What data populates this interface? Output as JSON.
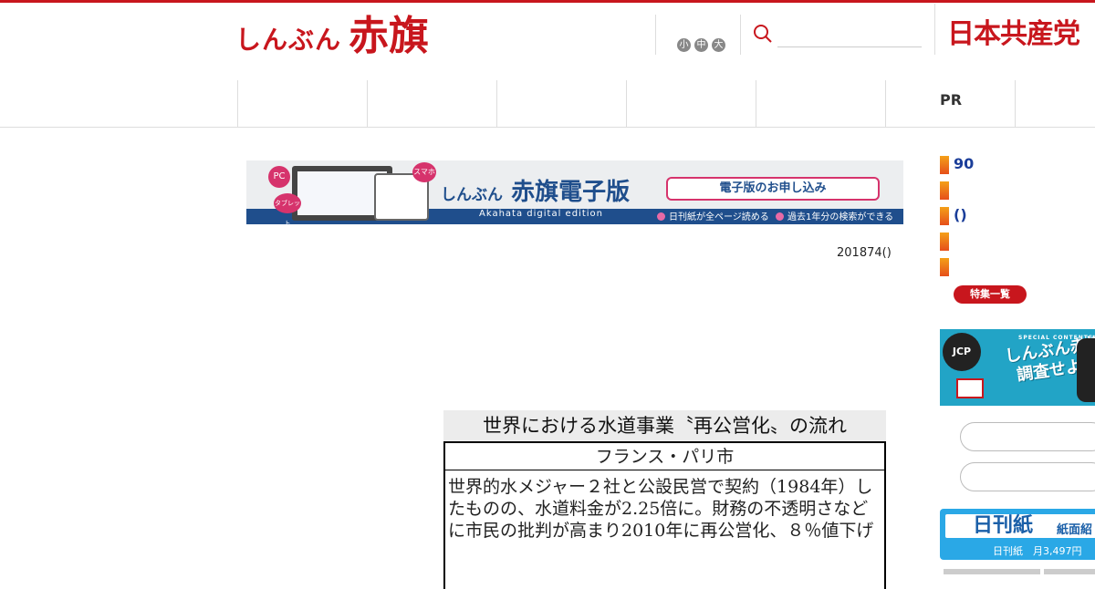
{
  "header": {
    "logo_small": "しんぶん",
    "logo_big": "赤旗",
    "font_sizes": [
      "小",
      "中",
      "大"
    ],
    "search_placeholder": "",
    "party_logo": "日本共産党"
  },
  "nav": {
    "pr_label": "PR"
  },
  "banner": {
    "title_small": "しんぶん",
    "title_big": "赤旗電子版",
    "cta": "電子版のお申し込み",
    "english": "Akahata digital edition",
    "feature1": "日刊紙が全ページ読める",
    "feature2": "過去1年分の検索ができる",
    "bubble_pc": "PC",
    "bubble_tablet": "タブレット",
    "bubble_phone": "スマホ"
  },
  "article": {
    "date": "201874()"
  },
  "table": {
    "heading": "世界における水道事業〝再公営化〟の流れ",
    "city": "フランス・パリ市",
    "body": "世界的水メジャー２社と公設民営で契約（1984年）したものの、水道料金が2.25倍に。財務の不透明さなどに市民の批判が高まり2010年に再公営化、８％値下げ"
  },
  "sidebar": {
    "items": [
      "90",
      "",
      "()",
      "",
      ""
    ],
    "tokushu_button": "特集一覧",
    "jcp_badge": "JCP",
    "jcp_sub": "SPECIAL CONTENTS",
    "jcp_line1": "しんぶん赤旗を",
    "jcp_line2": "調査せよ!",
    "nikkan_title": "日刊紙",
    "nikkan_sub": "紙面紹",
    "nikkan_price": "日刊紙　月3,497円"
  },
  "colors": {
    "brand_red": "#c8161d",
    "navy": "#1f4e8c",
    "link_blue": "#1a3d99",
    "sky": "#2aa8e6"
  }
}
